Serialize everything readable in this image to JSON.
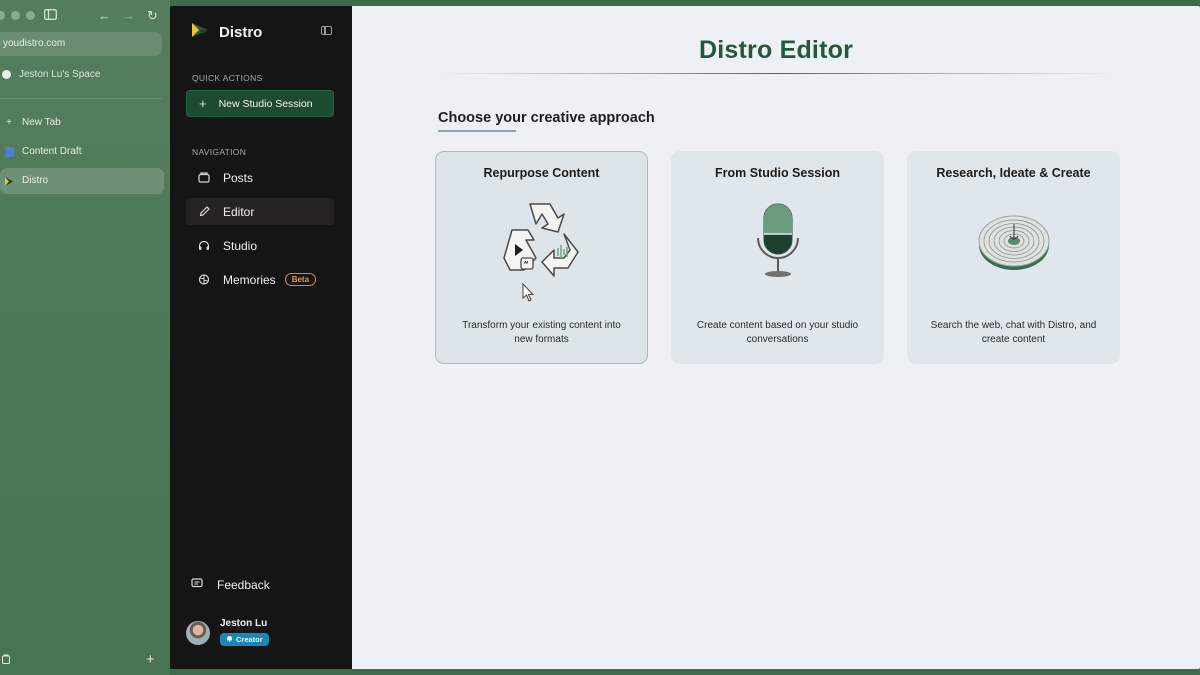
{
  "browser": {
    "url": "youdistro.com",
    "space": "Jeston Lu's Space",
    "new_tab": "New Tab",
    "tabs": [
      {
        "label": "Content Draft",
        "icon": "document-icon"
      },
      {
        "label": "Distro",
        "icon": "distro-logo-icon",
        "active": true
      }
    ]
  },
  "sidebar": {
    "brand": "Distro",
    "quick_actions_label": "Quick Actions",
    "new_session_label": "New Studio Session",
    "navigation_label": "Navigation",
    "nav": [
      {
        "label": "Posts",
        "icon": "posts-icon"
      },
      {
        "label": "Editor",
        "icon": "pencil-icon",
        "active": true
      },
      {
        "label": "Studio",
        "icon": "headphones-icon"
      },
      {
        "label": "Memories",
        "icon": "brain-icon",
        "badge": "Beta"
      }
    ],
    "feedback_label": "Feedback",
    "user": {
      "name": "Jeston Lu",
      "role": "Creator"
    }
  },
  "main": {
    "title": "Distro Editor",
    "subtitle": "Choose your creative approach",
    "cards": [
      {
        "title": "Repurpose Content",
        "desc": "Transform your existing content into new formats",
        "icon": "recycle-icon"
      },
      {
        "title": "From Studio Session",
        "desc": "Create content based on your studio conversations",
        "icon": "microphone-icon"
      },
      {
        "title": "Research, Ideate & Create",
        "desc": "Search the web, chat with Distro, and create content",
        "icon": "research-disc-icon"
      }
    ]
  },
  "colors": {
    "brand_green": "#25583b",
    "sidebar_bg": "#151516",
    "main_bg": "#edf1f5",
    "card_bg": "#dfe6ec",
    "beta": "#d98c3a",
    "creator": "#1b87b4"
  }
}
